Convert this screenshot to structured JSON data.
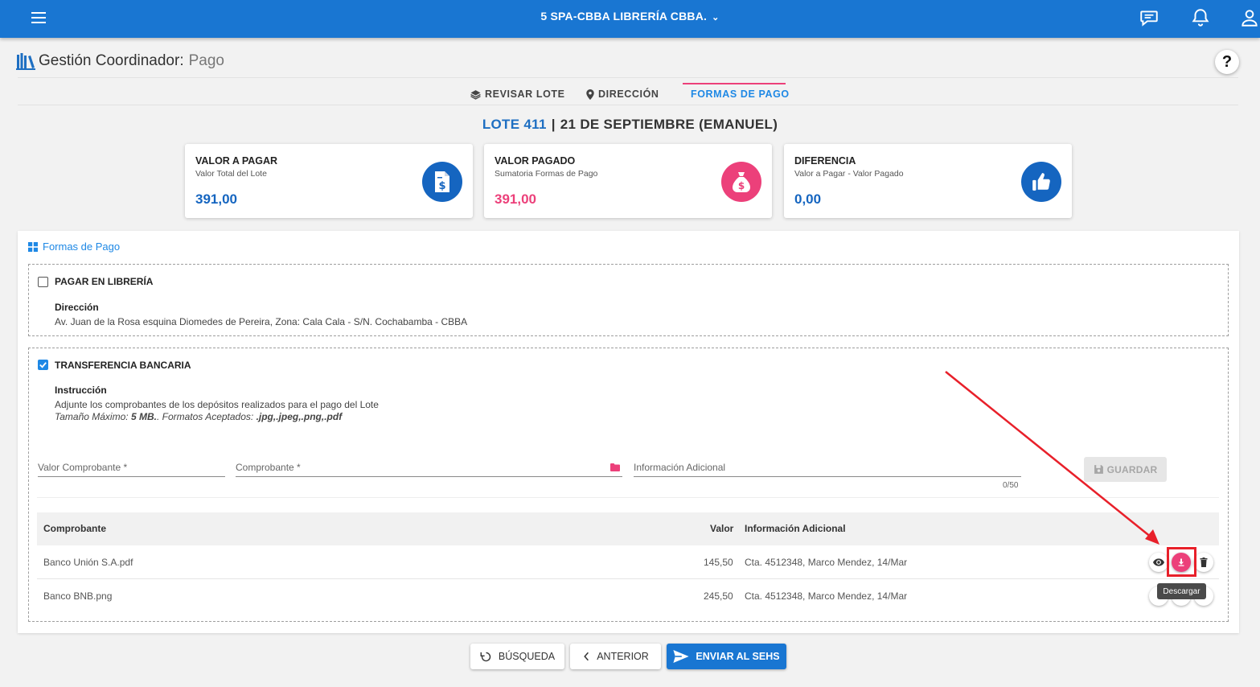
{
  "topbar": {
    "title": "5 SPA-CBBA LIBRERÍA CBBA.",
    "icons": [
      "menu-icon",
      "chat-icon",
      "bell-icon",
      "user-icon"
    ]
  },
  "page": {
    "title": "Gestión Coordinador:",
    "subtitle": "Pago",
    "help": "?"
  },
  "tabs": [
    {
      "label": "REVISAR LOTE",
      "icon": "layers-icon"
    },
    {
      "label": "DIRECCIÓN",
      "icon": "map-pin-icon"
    },
    {
      "label": "FORMAS DE PAGO",
      "active": true
    }
  ],
  "lote": {
    "number": "LOTE 411",
    "separator": "|",
    "name": "21 DE SEPTIEMBRE (EMANUEL)"
  },
  "cards": [
    {
      "title": "VALOR A PAGAR",
      "subtitle": "Valor Total del Lote",
      "value": "391,00",
      "color": "#1565c0",
      "icon": "invoice-dollar-icon"
    },
    {
      "title": "VALOR PAGADO",
      "subtitle": "Sumatoria Formas de Pago",
      "value": "391,00",
      "color": "#ec407a",
      "icon": "money-bag-icon"
    },
    {
      "title": "DIFERENCIA",
      "subtitle": "Valor a Pagar - Valor Pagado",
      "value": "0,00",
      "color": "#1565c0",
      "icon": "thumbs-up-icon"
    }
  ],
  "payment_section": {
    "title": "Formas de Pago"
  },
  "pagar_libreria": {
    "label": "PAGAR EN LIBRERÍA",
    "checked": false,
    "address_label": "Dirección",
    "address": "Av. Juan de la Rosa esquina Diomedes de Pereira, Zona: Cala Cala - S/N. Cochabamba - CBBA"
  },
  "transferencia": {
    "label": "TRANSFERENCIA BANCARIA",
    "checked": true,
    "instruction_label": "Instrucción",
    "instruction": "Adjunte los comprobantes de los depósitos realizados para el pago del Lote",
    "size_prefix": "Tamaño Máximo: ",
    "size_value": "5 MB.",
    "formats_prefix": ". Formatos Aceptados: ",
    "formats_value": ".jpg,.jpeg,.png,.pdf",
    "fields": {
      "valor": "Valor Comprobante *",
      "comprobante": "Comprobante *",
      "info": "Información Adicional",
      "counter": "0/50"
    },
    "save_label": "GUARDAR"
  },
  "table": {
    "headers": {
      "comprobante": "Comprobante",
      "valor": "Valor",
      "info": "Información Adicional"
    },
    "rows": [
      {
        "comprobante": "Banco Unión S.A.pdf",
        "valor": "145,50",
        "info": "Cta. 4512348, Marco Mendez, 14/Mar"
      },
      {
        "comprobante": "Banco BNB.png",
        "valor": "245,50",
        "info": "Cta. 4512348, Marco Mendez, 14/Mar"
      }
    ],
    "tooltip": "Descargar"
  },
  "footer": {
    "busqueda": "BÚSQUEDA",
    "anterior": "ANTERIOR",
    "enviar": "ENVIAR AL SEHS"
  },
  "colors": {
    "primary": "#1976d2",
    "accent": "#ec407a",
    "annotation": "#e8202a"
  }
}
